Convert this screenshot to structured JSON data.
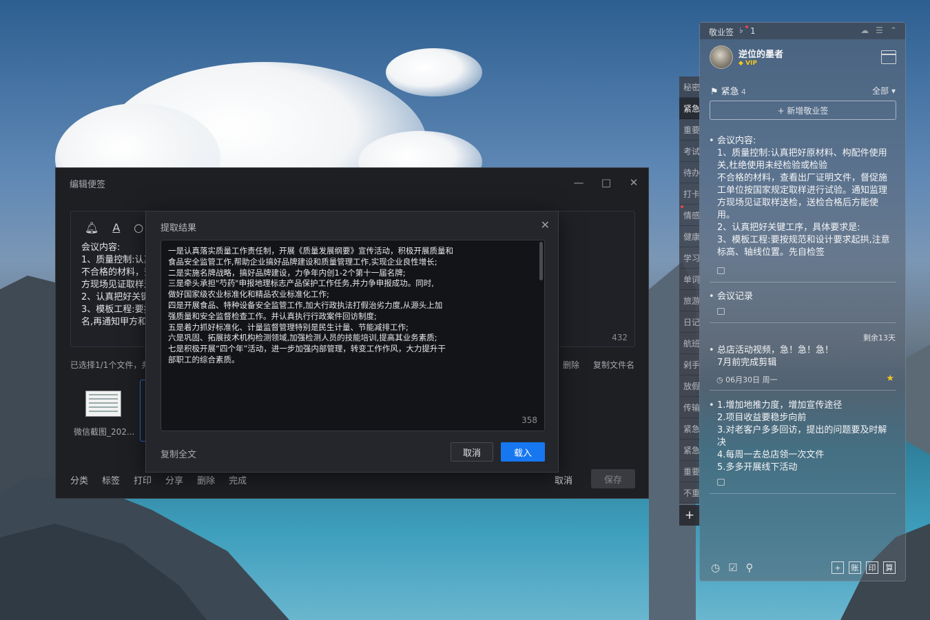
{
  "editor": {
    "title": "编辑便签",
    "content_lines": [
      "会议内容:",
      "1、质量控制:认真",
      "不合格的材料，查",
      "方现场见证取样送",
      "2、认真把好关键",
      "3、模板工程:要按",
      "名,再通知甲方和"
    ],
    "char_count": "432",
    "file_info": "已选择1/1个文件，共",
    "file_ops": [
      "删除",
      "复制文件名"
    ],
    "thumb_label": "微信截图_202...",
    "bottom_ops": [
      "分类",
      "标签",
      "打印",
      "分享",
      "删除",
      "完成"
    ],
    "cancel": "取消",
    "save": "保存"
  },
  "dialog": {
    "title": "提取结果",
    "lines": [
      "一是认真落实质量工作责任制，开展《质量发展纲要》宣传活动，积极开展质量和",
      "食品安全监管工作,帮助企业搞好品牌建设和质量管理工作,实现企业良性增长;",
      "二是实施名牌战略，搞好品牌建设，力争年内创1-2个第十一届名牌;",
      "三是牵头承担\"芍药\"申报地理标志产品保护工作任务,并力争申报成功。同时,",
      "做好国家级农业标准化和精品农业标准化工作;",
      "四是开展食品、特种设备安全监管工作,加大行政执法打假治劣力度,从源头上加",
      "强质量和安全监督检查工作。并认真执行行政案件回访制度;",
      "五是着力抓好标准化、计量监督管理特别是民生计量、节能减排工作;",
      "六是巩固、拓展技术机构检测领域,加强检测人员的技能培训,提高其业务素质;",
      "七是积极开展“四个年”活动，进一步加强内部管理，转变工作作风，大力提升干",
      "部职工的综合素质。"
    ],
    "char_count": "358",
    "copy_all": "复制全文",
    "cancel": "取消",
    "load": "载入"
  },
  "side_tabs": [
    "秘密",
    "紧急",
    "重要",
    "考试",
    "待办",
    "打卡",
    "情感",
    "健康",
    "学习",
    "单词",
    "旅游",
    "日记",
    "航班",
    "剁手",
    "放假",
    "传输",
    "紧急",
    "紧急",
    "重要",
    "不重"
  ],
  "side_add": "+",
  "panel": {
    "app_title": "敬业签",
    "bell_count": "1",
    "user_name": "逆位的墨者",
    "vip": "VIP",
    "category": "紧急",
    "category_count": "4",
    "filter": "全部",
    "new_button": "+ 新增敬业签",
    "notes": [
      {
        "lines": [
          "会议内容:",
          "1、质量控制:认真把好原材料、构配件使用",
          "关,杜绝使用未经检验或检验",
          "不合格的材料，查看出厂证明文件，督促施",
          "工单位按国家规定取样进行试验。通知监理",
          "方现场见证取样送检，送检合格后方能使",
          "用。",
          "2、认真把好关键工序，具体要求是:",
          "3、模板工程:要按规范和设计要求起拱,注意",
          "标高、轴线位置。先自检签"
        ]
      },
      {
        "lines": [
          "会议记录"
        ]
      },
      {
        "lines": [
          "总店活动视频，急！急！急！",
          "7月前完成剪辑"
        ]
      },
      {
        "lines": [
          "1.增加地推力度，增加宣传途径",
          "2.项目收益要稳步向前",
          "3.对老客户多多回访，提出的问题要及时解",
          "决",
          "4.每周一去总店领一次文件",
          "5.多多开展线下活动"
        ]
      }
    ],
    "remain": "剩余13天",
    "date": "06月30日 周一",
    "footer_right": [
      "+",
      "账",
      "印",
      "算"
    ],
    "accent": "#1677f0"
  }
}
